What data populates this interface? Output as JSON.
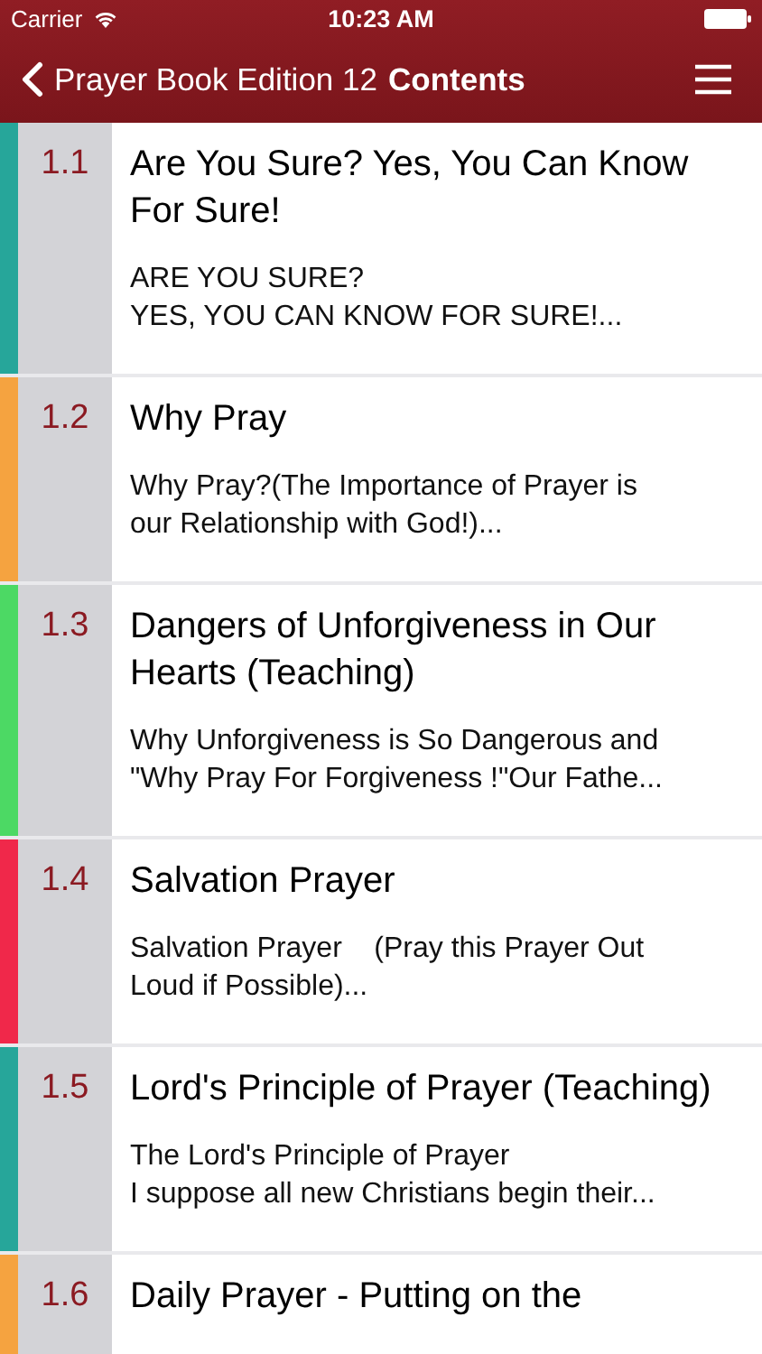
{
  "status_bar": {
    "carrier": "Carrier",
    "time": "10:23 AM"
  },
  "nav_bar": {
    "back_label": "Prayer Book Edition 12",
    "title": "Contents"
  },
  "rows": [
    {
      "number": "1.1",
      "title": "Are You Sure? Yes, You Can Know For Sure!",
      "preview": "ARE YOU SURE?\nYES, YOU CAN KNOW FOR SURE!...",
      "color": "#26a69a"
    },
    {
      "number": "1.2",
      "title": "Why Pray",
      "preview": "Why Pray?(The Importance of Prayer is\nour Relationship with God!)...",
      "color": "#f5a340"
    },
    {
      "number": "1.3",
      "title": "Dangers of Unforgiveness in Our Hearts (Teaching)",
      "preview": "Why Unforgiveness is So Dangerous and\n\"Why Pray For Forgiveness !\"Our Fathe...",
      "color": "#4cd964"
    },
    {
      "number": "1.4",
      "title": "Salvation Prayer",
      "preview": "Salvation Prayer    (Pray this Prayer Out\nLoud if Possible)...",
      "color": "#f0284a"
    },
    {
      "number": "1.5",
      "title": "Lord's Principle of Prayer (Teaching)",
      "preview": "The Lord's Principle of Prayer\nI suppose all new Christians begin their...",
      "color": "#26a69a"
    },
    {
      "number": "1.6",
      "title": "Daily Prayer - Putting on the",
      "color": "#f5a340"
    }
  ]
}
